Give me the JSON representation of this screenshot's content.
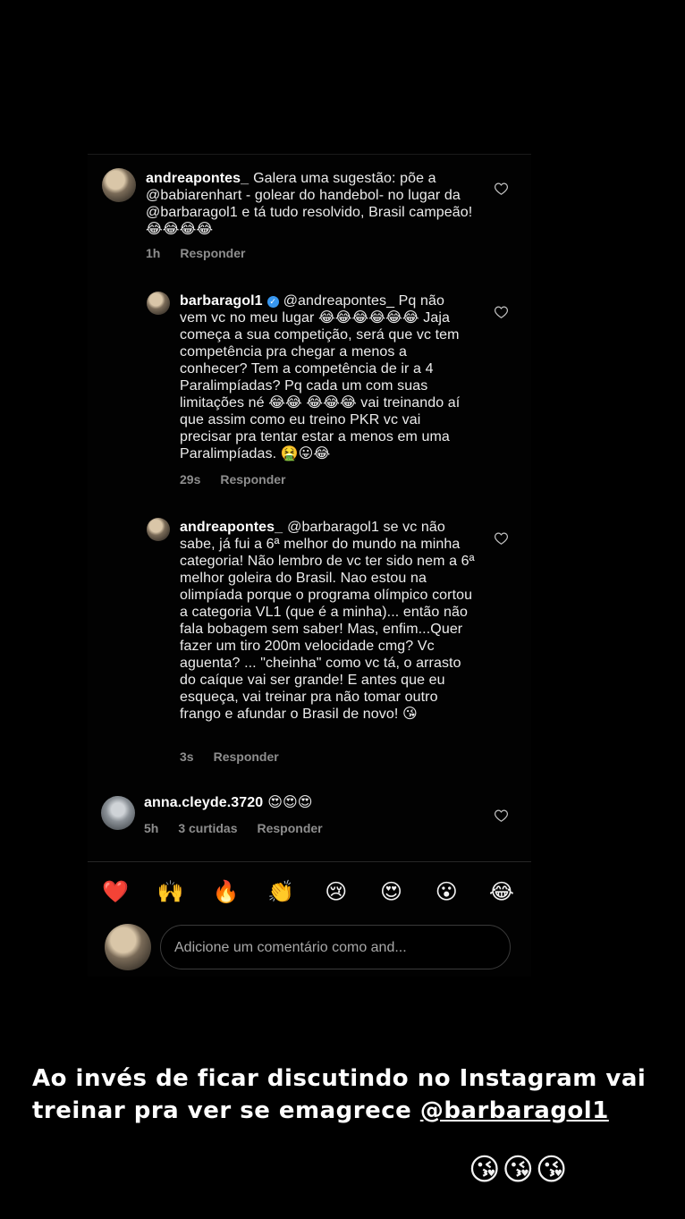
{
  "comments": [
    {
      "username": "andreapontes_",
      "text": "Galera uma sugestão: põe a @babiarenhart - golear do handebol- no lugar da @barbaragol1 e tá tudo resolvido, Brasil campeão! 😂😂😂😂",
      "time": "1h",
      "reply_label": "Responder"
    },
    {
      "username": "barbaragol1",
      "verified": true,
      "text": "@andreapontes_ Pq não vem vc no meu lugar 😂😂😂😂😂😂 Jaja começa a sua competição, será que vc tem competência pra chegar a menos a conhecer? Tem a competência de ir a 4 Paralimpíadas? Pq cada um com suas limitações né 😂😂 😂😂😂 vai treinando aí que assim como eu treino PKR vc vai precisar pra tentar estar a menos em uma Paralimpíadas. 🤮😛😂",
      "time": "29s",
      "reply_label": "Responder"
    },
    {
      "username": "andreapontes_",
      "text": "@barbaragol1 se vc não sabe, já fui a 6ª melhor do mundo na minha categoria! Não lembro de vc ter sido nem a 6ª melhor goleira do Brasil. Nao estou na olimpíada porque o programa olímpico cortou a categoria VL1 (que é a minha)... então não fala bobagem sem saber! Mas, enfim...Quer fazer um tiro 200m velocidade cmg? Vc aguenta? ... \"cheinha\" como vc tá, o arrasto do caíque vai ser grande! E antes que eu esqueça, vai treinar pra não tomar outro frango e afundar o Brasil de novo! 😘",
      "time": "3s",
      "reply_label": "Responder"
    },
    {
      "username": "anna.cleyde.3720",
      "text": "😍😍😍",
      "time": "5h",
      "likes": "3 curtidas",
      "reply_label": "Responder"
    }
  ],
  "reactions": [
    "❤️",
    "🙌",
    "🔥",
    "👏",
    "😢",
    "😍",
    "😮",
    "😂"
  ],
  "comment_input": {
    "placeholder": "Adicione um comentário como and..."
  },
  "caption": {
    "text": "Ao invés de ficar discutindo no Instagram vai treinar pra ver se emagrece ",
    "mention": "@barbaragol1",
    "emojis": "😘😘😘"
  }
}
